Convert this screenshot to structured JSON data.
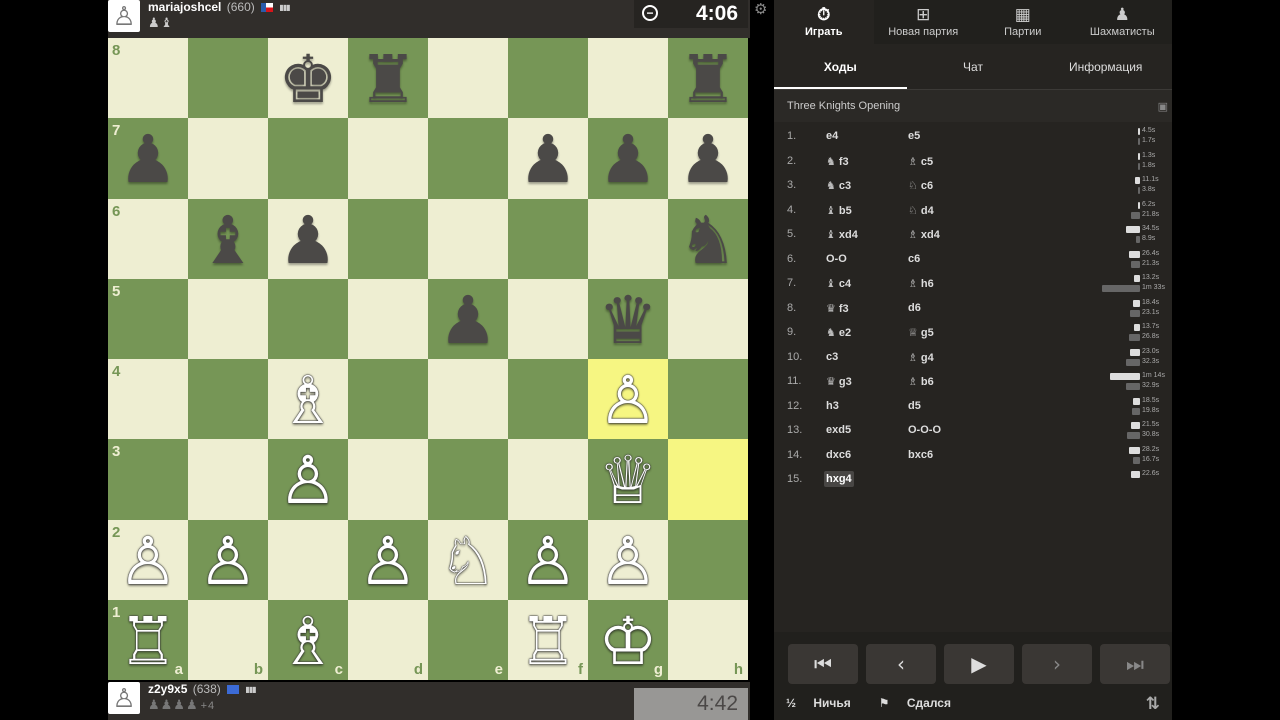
{
  "top_player": {
    "name": "mariajoshcel",
    "rating": "(660)",
    "captured": "♟♝",
    "clock": "4:06",
    "avatar": "♙"
  },
  "bottom_player": {
    "name": "z2y9x5",
    "rating": "(638)",
    "captured": "♟♟♟♟",
    "captured_extra": "+4",
    "clock": "4:42",
    "avatar": "♙"
  },
  "board": {
    "files": [
      "a",
      "b",
      "c",
      "d",
      "e",
      "f",
      "g",
      "h"
    ],
    "ranks": [
      "8",
      "7",
      "6",
      "5",
      "4",
      "3",
      "2",
      "1"
    ],
    "highlighted": [
      "g4",
      "h3"
    ],
    "position": {
      "8": [
        "",
        "",
        "♚",
        "♜",
        "",
        "",
        "",
        "♜"
      ],
      "7": [
        "♟",
        "",
        "",
        "",
        "",
        "♟",
        "♟",
        "♟"
      ],
      "6": [
        "",
        "♝",
        "♟",
        "",
        "",
        "",
        "",
        "♞"
      ],
      "5": [
        "",
        "",
        "",
        "",
        "♟",
        "",
        "♛",
        ""
      ],
      "4": [
        "",
        "",
        "♗",
        "",
        "",
        "",
        "♙",
        ""
      ],
      "3": [
        "",
        "",
        "♙",
        "",
        "",
        "",
        "♕",
        ""
      ],
      "2": [
        "♙",
        "♙",
        "",
        "♙",
        "♘",
        "♙",
        "♙",
        ""
      ],
      "1": [
        "♖",
        "",
        "♗",
        "",
        "",
        "♖",
        "♔",
        ""
      ]
    },
    "colors": {
      "8": [
        "",
        "",
        "b",
        "b",
        "",
        "",
        "",
        "b"
      ],
      "7": [
        "b",
        "",
        "",
        "",
        "",
        "b",
        "b",
        "b"
      ],
      "6": [
        "",
        "b",
        "b",
        "",
        "",
        "",
        "",
        "b"
      ],
      "5": [
        "",
        "",
        "",
        "",
        "b",
        "",
        "b",
        ""
      ],
      "4": [
        "",
        "",
        "w",
        "",
        "",
        "",
        "w",
        ""
      ],
      "3": [
        "",
        "",
        "w",
        "",
        "",
        "",
        "w",
        ""
      ],
      "2": [
        "w",
        "w",
        "",
        "w",
        "w",
        "w",
        "w",
        ""
      ],
      "1": [
        "w",
        "",
        "w",
        "",
        "",
        "w",
        "w",
        ""
      ]
    }
  },
  "nav": {
    "tabs": [
      {
        "icon": "⏱",
        "label": "Играть",
        "active": true
      },
      {
        "icon": "⊞",
        "label": "Новая партия",
        "active": false
      },
      {
        "icon": "▦",
        "label": "Партии",
        "active": false
      },
      {
        "icon": "♟",
        "label": "Шахматисты",
        "active": false
      }
    ]
  },
  "subtabs": [
    {
      "label": "Ходы",
      "active": true
    },
    {
      "label": "Чат",
      "active": false
    },
    {
      "label": "Информация",
      "active": false
    }
  ],
  "opening": "Three Knights Opening",
  "moves": [
    {
      "n": "1.",
      "w": "e4",
      "wf": "",
      "b": "e5",
      "bf": "",
      "wt": "4.5s",
      "bt": "1.7s",
      "wp": 0.03,
      "bp": 0.01
    },
    {
      "n": "2.",
      "w": "f3",
      "wf": "♞",
      "b": "c5",
      "bf": "♗",
      "wt": "1.3s",
      "bt": "1.8s",
      "wp": 0.01,
      "bp": 0.01
    },
    {
      "n": "3.",
      "w": "c3",
      "wf": "♞",
      "b": "c6",
      "bf": "♘",
      "wt": "11.1s",
      "bt": "3.8s",
      "wp": 0.06,
      "bp": 0.02
    },
    {
      "n": "4.",
      "w": "b5",
      "wf": "♝",
      "b": "d4",
      "bf": "♘",
      "wt": "6.2s",
      "bt": "21.8s",
      "wp": 0.03,
      "bp": 0.11
    },
    {
      "n": "5.",
      "w": "xd4",
      "wf": "♝",
      "b": "xd4",
      "bf": "♗",
      "wt": "34.5s",
      "bt": "8.9s",
      "wp": 0.18,
      "bp": 0.05
    },
    {
      "n": "6.",
      "w": "O-O",
      "wf": "",
      "b": "c6",
      "bf": "",
      "wt": "26.4s",
      "bt": "21.3s",
      "wp": 0.14,
      "bp": 0.11
    },
    {
      "n": "7.",
      "w": "c4",
      "wf": "♝",
      "b": "h6",
      "bf": "♗",
      "wt": "13.2s",
      "bt": "1m 33s",
      "wp": 0.07,
      "bp": 0.48
    },
    {
      "n": "8.",
      "w": "f3",
      "wf": "♛",
      "b": "d6",
      "bf": "",
      "wt": "18.4s",
      "bt": "23.1s",
      "wp": 0.09,
      "bp": 0.12
    },
    {
      "n": "9.",
      "w": "e2",
      "wf": "♞",
      "b": "g5",
      "bf": "♕",
      "wt": "13.7s",
      "bt": "26.8s",
      "wp": 0.07,
      "bp": 0.14
    },
    {
      "n": "10.",
      "w": "c3",
      "wf": "",
      "b": "g4",
      "bf": "♗",
      "wt": "23.0s",
      "bt": "32.3s",
      "wp": 0.12,
      "bp": 0.17
    },
    {
      "n": "11.",
      "w": "g3",
      "wf": "♛",
      "b": "b6",
      "bf": "♗",
      "wt": "1m 14s",
      "bt": "32.9s",
      "wp": 0.38,
      "bp": 0.17
    },
    {
      "n": "12.",
      "w": "h3",
      "wf": "",
      "b": "d5",
      "bf": "",
      "wt": "18.5s",
      "bt": "19.8s",
      "wp": 0.09,
      "bp": 0.1
    },
    {
      "n": "13.",
      "w": "exd5",
      "wf": "",
      "b": "O-O-O",
      "bf": "",
      "wt": "21.5s",
      "bt": "30.8s",
      "wp": 0.11,
      "bp": 0.16
    },
    {
      "n": "14.",
      "w": "dxc6",
      "wf": "",
      "b": "bxc6",
      "bf": "",
      "wt": "28.2s",
      "bt": "16.7s",
      "wp": 0.14,
      "bp": 0.09
    },
    {
      "n": "15.",
      "w": "hxg4",
      "wf": "",
      "b": "",
      "bf": "",
      "wt": "22.6s",
      "bt": "",
      "wp": 0.11,
      "bp": 0,
      "current": true
    }
  ],
  "controls": {
    "first": "⏮",
    "prev": "‹",
    "play": "▶",
    "next": "›",
    "last": "⏭"
  },
  "footer": {
    "draw_icon": "½",
    "draw_label": "Ничья",
    "resign_icon": "⚑",
    "resign_label": "Сдался",
    "flip_icon": "⇅"
  },
  "colors": {
    "light_square": "#eeeed2",
    "dark_square": "#769656",
    "highlight_light": "#f6f682",
    "highlight_dark": "#baca2b",
    "panel_bg": "#262421"
  }
}
